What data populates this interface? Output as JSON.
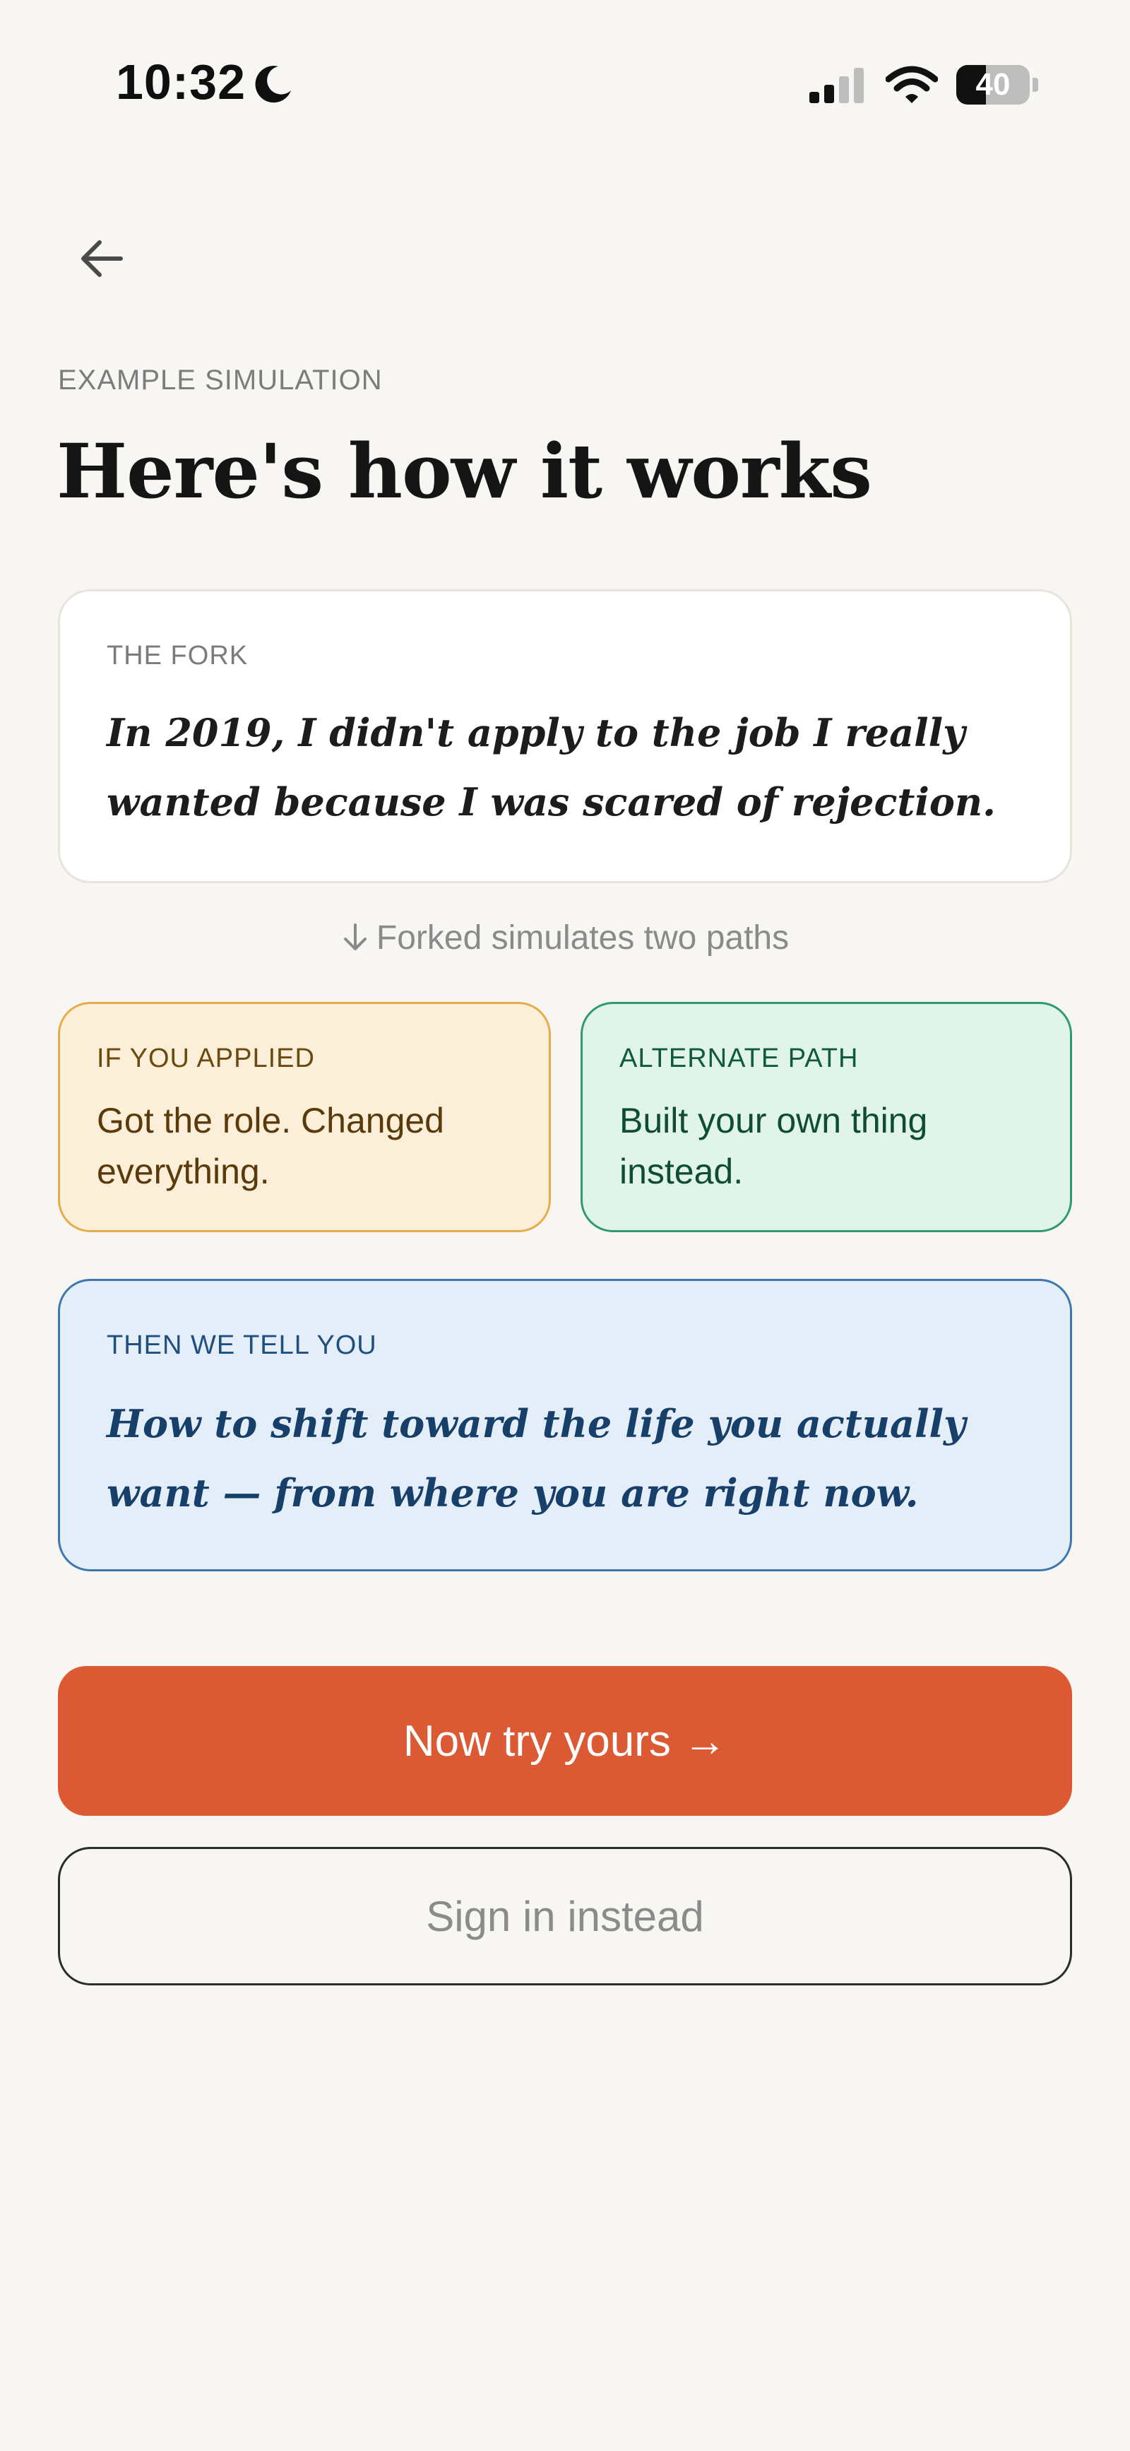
{
  "status_bar": {
    "time": "10:32",
    "battery_level": "40",
    "battery_fraction": 0.4
  },
  "header": {
    "eyebrow": "EXAMPLE SIMULATION",
    "title": "Here's how it works"
  },
  "fork_card": {
    "label": "THE FORK",
    "text": "In 2019, I didn't apply to the job I really wanted because I was scared of rejection."
  },
  "fork_note": "Forked simulates two paths",
  "paths": {
    "applied": {
      "label": "IF YOU APPLIED",
      "text": "Got the role. Changed everything."
    },
    "alternate": {
      "label": "ALTERNATE PATH",
      "text": "Built your own thing instead."
    }
  },
  "tell_card": {
    "label": "THEN WE TELL YOU",
    "text": "How to shift toward the life you actually want — from where you are right now."
  },
  "actions": {
    "primary_label": "Now try yours →",
    "secondary_label": "Sign in instead"
  },
  "colors": {
    "background": "#f7f6f3",
    "primary": "#dc5a33",
    "applied_border": "#e6ac47",
    "applied_bg": "#fbefd9",
    "alternate_border": "#2f9a70",
    "alternate_bg": "#e1f4ec",
    "tell_border": "#3e77ad",
    "tell_bg": "#e4eef8"
  }
}
